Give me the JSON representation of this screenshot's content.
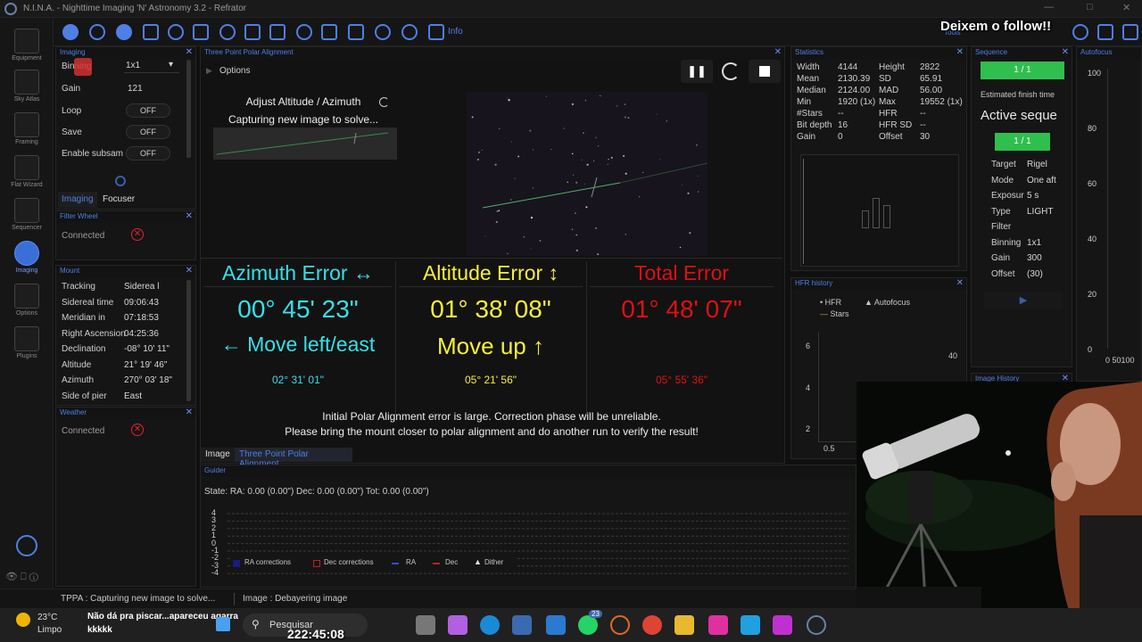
{
  "title": "N.I.N.A. - Nighttime Imaging 'N' Astronomy 3.2   -   Refrator",
  "overlay": {
    "follow": "Deixem o follow!!"
  },
  "nav": [
    {
      "label": "Equipment"
    },
    {
      "label": "Sky Atlas"
    },
    {
      "label": "Framing"
    },
    {
      "label": "Flat Wizard"
    },
    {
      "label": "Sequencer"
    },
    {
      "label": "Imaging"
    },
    {
      "label": "Options"
    },
    {
      "label": "Plugins"
    }
  ],
  "toolbar": {
    "info": "Info",
    "tools": "Tools"
  },
  "imaging": {
    "header": "Imaging",
    "binning_label": "Binning",
    "binning_value": "1x1",
    "gain_label": "Gain",
    "gain_value": "121",
    "loop_label": "Loop",
    "loop_value": "OFF",
    "save_label": "Save",
    "save_value": "OFF",
    "subsample_label": "Enable subsam",
    "subsample_value": "OFF",
    "tab_imaging": "Imaging",
    "tab_focuser": "Focuser"
  },
  "filterwheel": {
    "header": "Filter Wheel",
    "status": "Connected"
  },
  "mount": {
    "header": "Mount",
    "rows": [
      {
        "label": "Tracking",
        "value": "Siderea l"
      },
      {
        "label": "Sidereal time",
        "value": "09:06:43"
      },
      {
        "label": "Meridian in",
        "value": "07:18:53"
      },
      {
        "label": "Right Ascension",
        "value": "04:25:36"
      },
      {
        "label": "Declination",
        "value": "-08° 10' 11\""
      },
      {
        "label": "Altitude",
        "value": "21° 19' 46\""
      },
      {
        "label": "Azimuth",
        "value": "270° 03' 18\""
      },
      {
        "label": "Side of pier",
        "value": "East"
      }
    ]
  },
  "weather": {
    "header": "Weather",
    "status": "Connected"
  },
  "tppa": {
    "header": "Three Point Polar Alignment",
    "options": "Options",
    "step_title": "Adjust Altitude / Azimuth",
    "step_status": "Capturing new image to solve...",
    "azimuth": {
      "title": "Azimuth Error ↔",
      "value": "00° 45' 23\"",
      "hint": "← Move left/east",
      "sub": "02° 31' 01\""
    },
    "altitude": {
      "title": "Altitude Error ↕",
      "value": "01° 38' 08\"",
      "hint": "Move up ↑",
      "sub": "05° 21' 56\""
    },
    "total": {
      "title": "Total Error",
      "value": "01° 48' 07\"",
      "sub": "05° 55' 36\""
    },
    "warning1": "Initial Polar Alignment error is large. Correction phase will be unreliable.",
    "warning2": "Please bring the mount closer to polar alignment and do another run to verify the result!",
    "tab_image": "Image",
    "tab_tppa": "Three Point Polar Alignment"
  },
  "guider": {
    "header": "Guider",
    "state": "State:  RA: 0.00 (0.00\")  Dec: 0.00 (0.00\")  Tot: 0.00 (0.00\")",
    "yticks": [
      "4",
      "3",
      "2",
      "1",
      "0",
      "-1",
      "-2",
      "-3",
      "-4"
    ],
    "legend": [
      "RA corrections",
      "Dec corrections",
      "RA",
      "Dec",
      "Dither"
    ]
  },
  "statistics": {
    "header": "Statistics",
    "rows": [
      {
        "l1": "Width",
        "v1": "4144",
        "l2": "Height",
        "v2": "2822"
      },
      {
        "l1": "Mean",
        "v1": "2130.39",
        "l2": "SD",
        "v2": "65.91"
      },
      {
        "l1": "Median",
        "v1": "2124.00",
        "l2": "MAD",
        "v2": "56.00"
      },
      {
        "l1": "Min",
        "v1": "1920 (1x)",
        "l2": "Max",
        "v2": "19552 (1x)"
      },
      {
        "l1": "#Stars",
        "v1": "--",
        "l2": "HFR",
        "v2": "--"
      },
      {
        "l1": "Bit depth",
        "v1": "16",
        "l2": "HFR SD",
        "v2": "--"
      },
      {
        "l1": "Gain",
        "v1": "0",
        "l2": "Offset",
        "v2": "30"
      }
    ]
  },
  "hfr": {
    "header": "HFR history",
    "legend_hfr": "HFR",
    "legend_af": "Autofocus",
    "legend_stars": "Stars",
    "y1": "6",
    "y2": "4",
    "y3": "2",
    "r1": "40",
    "x1": "0.5"
  },
  "sequence": {
    "header": "Sequence",
    "progress1": "1 / 1",
    "finish": "Estimated finish time",
    "active": "Active seque",
    "progress2": "1 / 1",
    "rows": [
      {
        "label": "Target",
        "value": "Rigel"
      },
      {
        "label": "Mode",
        "value": "One aft"
      },
      {
        "label": "Exposur",
        "value": "5 s"
      },
      {
        "label": "Type",
        "value": "LIGHT"
      },
      {
        "label": "Filter",
        "value": ""
      },
      {
        "label": "Binning",
        "value": "1x1"
      },
      {
        "label": "Gain",
        "value": "300"
      },
      {
        "label": "Offset",
        "value": "(30)"
      }
    ],
    "image_history": "Image History"
  },
  "autofocus": {
    "header": "Autofocus",
    "yticks": [
      "100",
      "80",
      "60",
      "40",
      "20",
      "0"
    ],
    "xlabel": "0 50100"
  },
  "status": {
    "tppa": "TPPA :   Capturing new image to solve...",
    "image": "Image :   Debayering image"
  },
  "taskbar": {
    "temp": "23°C",
    "weather": "Limpo",
    "search": "Pesquisar",
    "chat": "Não dá pra piscar...apareceu agarra",
    "chat2": "kkkkk",
    "clock": "222:45:08",
    "badge": "23"
  },
  "colors": {
    "accent": "#4f7fe6",
    "azimuth": "#35e0e8",
    "altitude": "#f5f03c",
    "total": "#e01010"
  }
}
